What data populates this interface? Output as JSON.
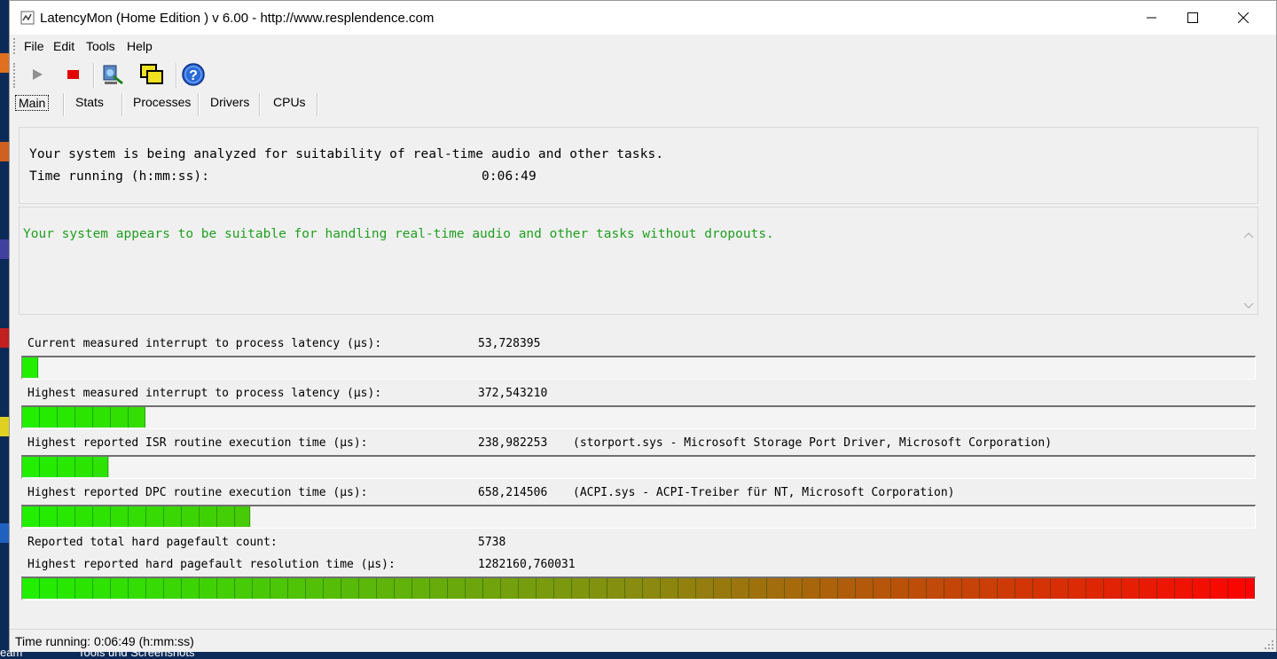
{
  "window": {
    "title": "LatencyMon  (Home Edition )  v 6.00 - http://www.resplendence.com",
    "controls": [
      "minimize-icon",
      "maximize-icon",
      "close-icon"
    ]
  },
  "menu": {
    "file": "File",
    "edit": "Edit",
    "tools": "Tools",
    "help": "Help"
  },
  "toolbar": {
    "icons": [
      "play-icon",
      "stop-icon",
      "analyze-icon",
      "windows-icon",
      "help-icon"
    ]
  },
  "tabs": {
    "main": "Main",
    "stats": "Stats",
    "processes": "Processes",
    "drivers": "Drivers",
    "cpus": "CPUs"
  },
  "header": {
    "analyzing": "Your system is being analyzed for suitability of real-time audio and other tasks.",
    "time_label": "Time running (h:mm:ss):",
    "time_value": "0:06:49"
  },
  "conclusion": {
    "text": "Your system appears to be suitable for handling real-time audio and other tasks without dropouts.",
    "color": "#20a020"
  },
  "metrics": [
    {
      "label": "Current measured interrupt to process latency (µs):",
      "value": "53,728395",
      "note": "",
      "bar_fraction": 0.013
    },
    {
      "label": "Highest measured interrupt to process latency (µs):",
      "value": "372,543210",
      "note": "",
      "bar_fraction": 0.1
    },
    {
      "label": "Highest reported ISR routine execution time (µs):",
      "value": "238,982253",
      "note": "(storport.sys - Microsoft Storage Port Driver, Microsoft Corporation)",
      "bar_fraction": 0.07
    },
    {
      "label": "Highest reported DPC routine execution time (µs):",
      "value": "658,214506",
      "note": "(ACPI.sys - ACPI-Treiber für NT, Microsoft Corporation)",
      "bar_fraction": 0.185
    }
  ],
  "pagefault": {
    "count_label": "Reported total hard pagefault count:",
    "count_value": "5738",
    "time_label": "Highest reported hard pagefault resolution time (µs):",
    "time_value": "1282160,760031",
    "bar_fraction": 1.0
  },
  "status": {
    "text": "Time running: 0:06:49  (h:mm:ss)"
  },
  "taskbar": {
    "item1": "eam",
    "item2": "Tools und Screenshots"
  },
  "colors": {
    "bar_start": "#22ee00",
    "bar_mid": "#8a8a10",
    "bar_end": "#ff0000"
  }
}
